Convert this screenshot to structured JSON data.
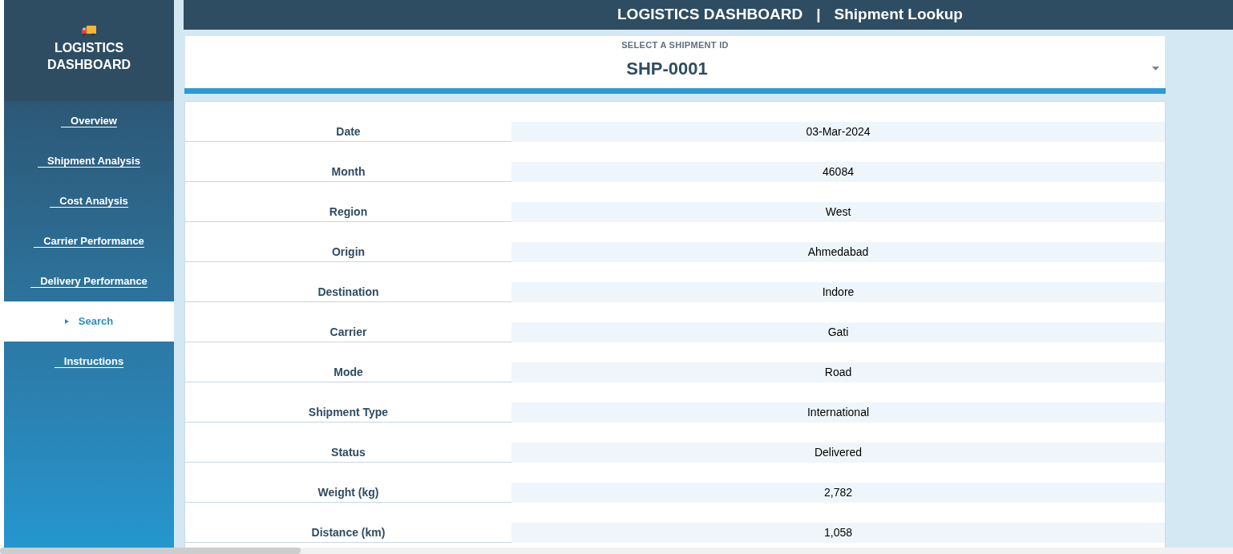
{
  "sidebar": {
    "logo": {
      "title": "LOGISTICS DASHBOARD"
    },
    "items": [
      {
        "label": "Overview",
        "selected": false
      },
      {
        "label": "Shipment Analysis",
        "selected": false
      },
      {
        "label": "Cost Analysis",
        "selected": false
      },
      {
        "label": "Carrier Performance",
        "selected": false
      },
      {
        "label": "Delivery Performance",
        "selected": false
      },
      {
        "label": "Search",
        "selected": true
      },
      {
        "label": "Instructions",
        "selected": false
      }
    ]
  },
  "header": {
    "title": "LOGISTICS DASHBOARD",
    "separator": "|",
    "subtitle": "Shipment Lookup"
  },
  "shipment_select": {
    "label": "SELECT A SHIPMENT ID",
    "value": "SHP-0001"
  },
  "details": [
    {
      "label": "Date",
      "value": "03-Mar-2024"
    },
    {
      "label": "Month",
      "value": "46084"
    },
    {
      "label": "Region",
      "value": "West"
    },
    {
      "label": "Origin",
      "value": "Ahmedabad"
    },
    {
      "label": "Destination",
      "value": "Indore"
    },
    {
      "label": "Carrier",
      "value": "Gati"
    },
    {
      "label": "Mode",
      "value": "Road"
    },
    {
      "label": "Shipment Type",
      "value": "International"
    },
    {
      "label": "Status",
      "value": "Delivered"
    },
    {
      "label": "Weight (kg)",
      "value": "2,782"
    },
    {
      "label": "Distance (km)",
      "value": "1,058"
    }
  ]
}
